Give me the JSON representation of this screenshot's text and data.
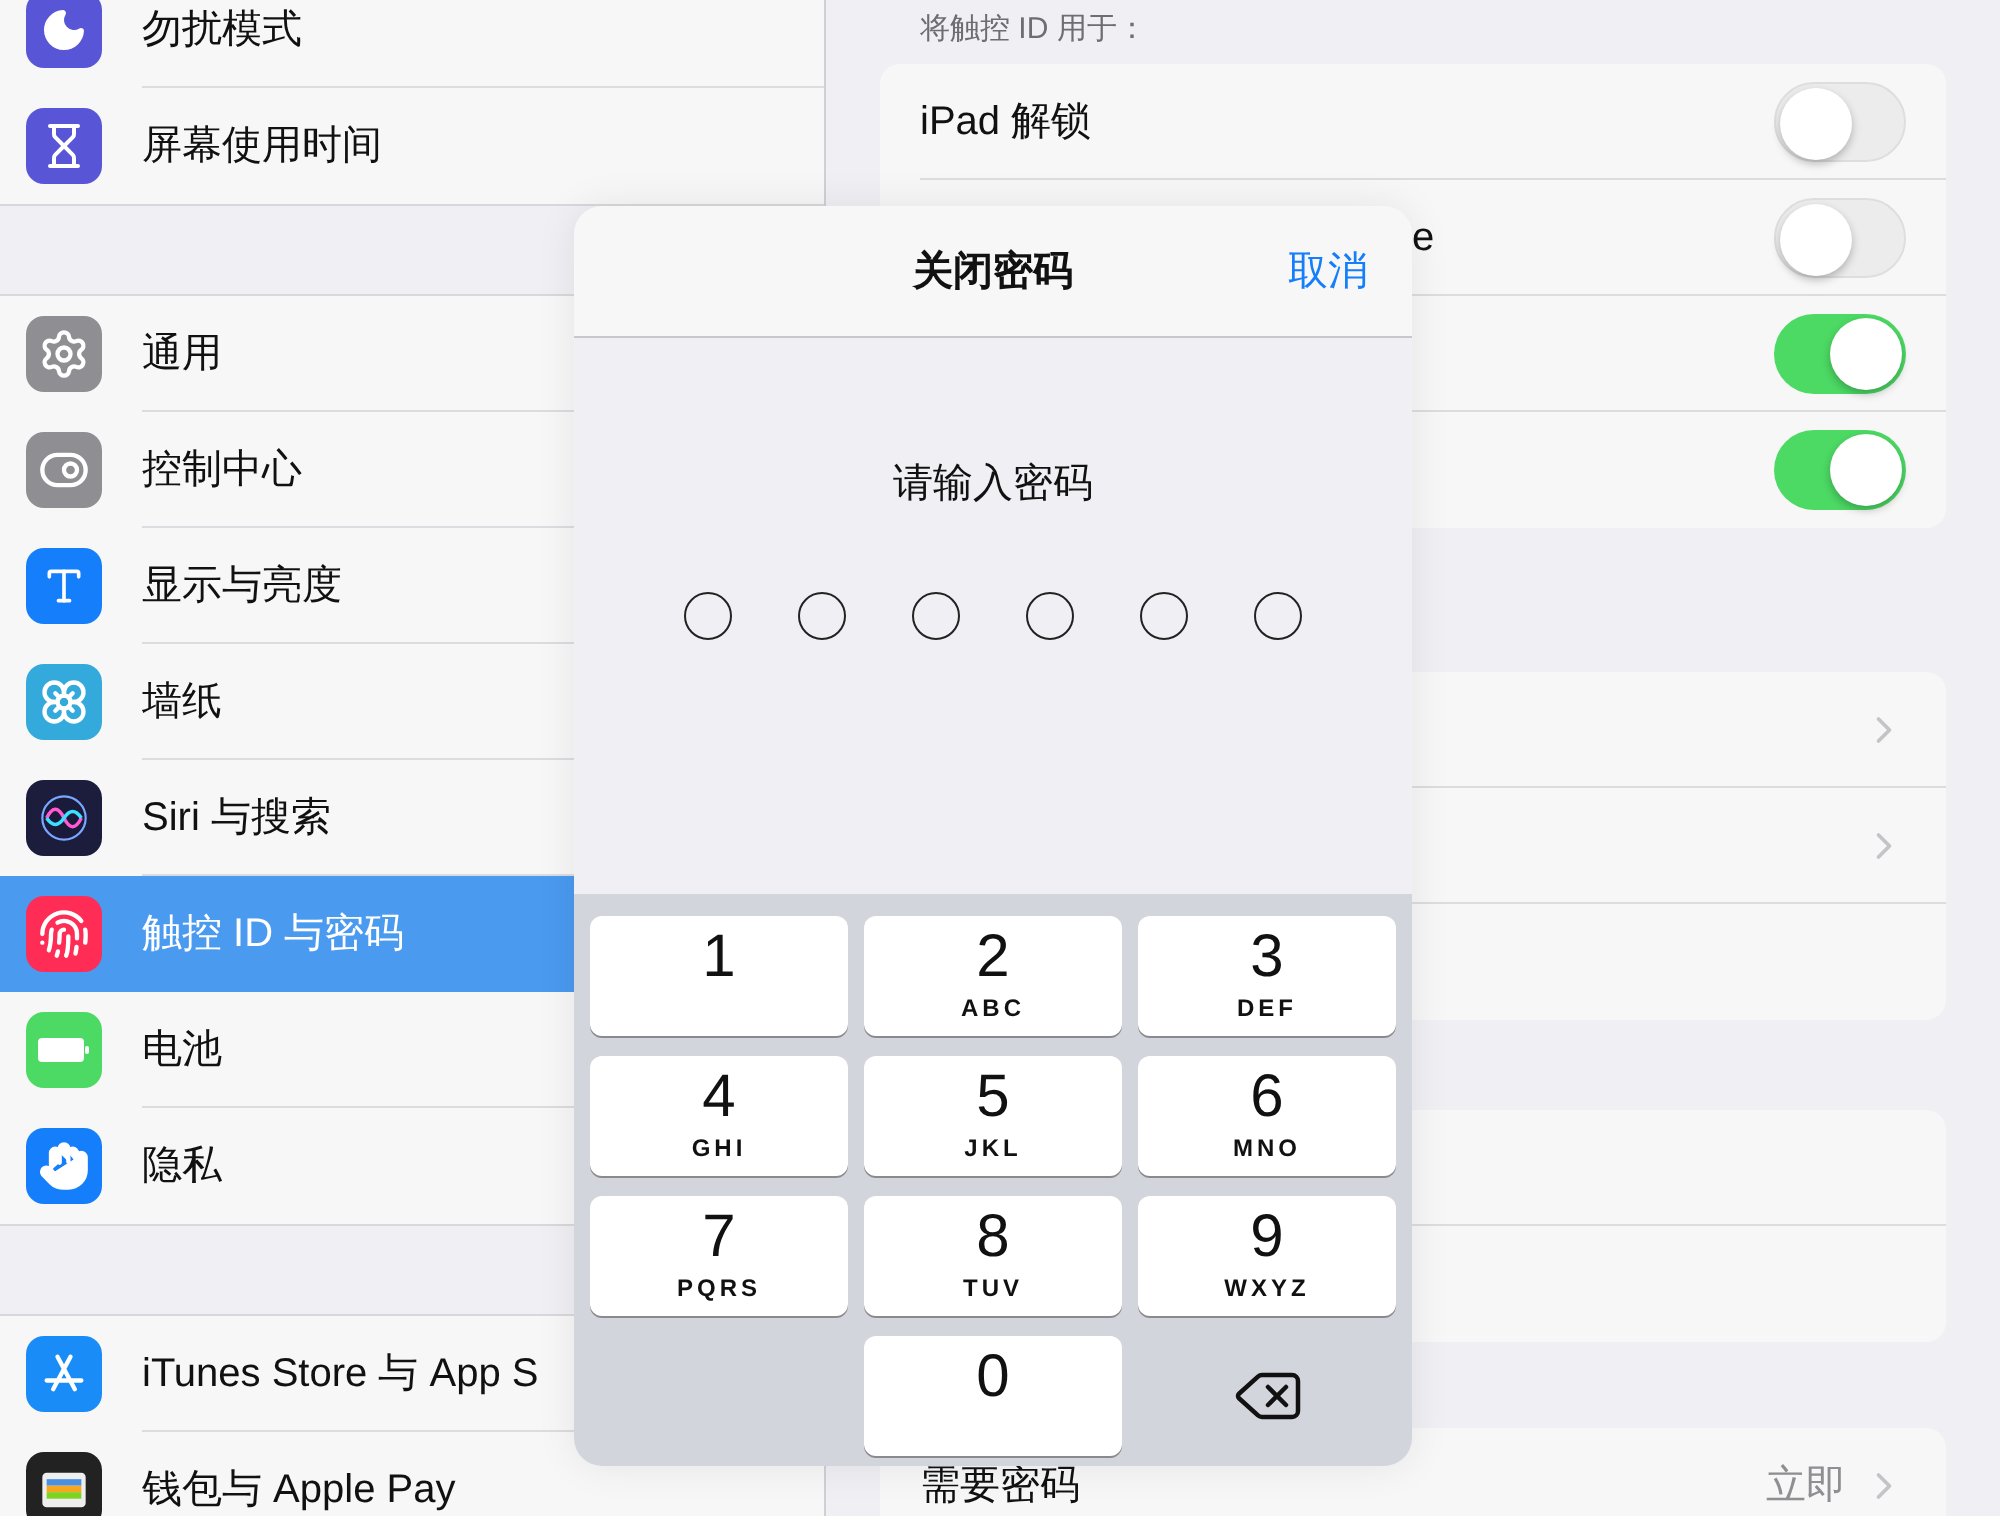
{
  "sidebar": {
    "groups": [
      {
        "items": [
          {
            "label": "勿扰模式",
            "selected": false
          },
          {
            "label": "屏幕使用时间",
            "selected": false
          }
        ]
      },
      {
        "items": [
          {
            "label": "通用",
            "selected": false
          },
          {
            "label": "控制中心",
            "selected": false
          },
          {
            "label": "显示与亮度",
            "selected": false
          },
          {
            "label": "墙纸",
            "selected": false
          },
          {
            "label": "Siri 与搜索",
            "selected": false
          },
          {
            "label": "触控 ID 与密码",
            "selected": true
          },
          {
            "label": "电池",
            "selected": false
          },
          {
            "label": "隐私",
            "selected": false
          }
        ]
      },
      {
        "items": [
          {
            "label": "iTunes Store 与 App S",
            "selected": false
          },
          {
            "label": "钱包与 Apple Pay",
            "selected": false
          }
        ]
      }
    ]
  },
  "sections": [
    {
      "header": "将触控 ID 用于：",
      "rows": [
        {
          "kind": "toggle",
          "label": "iPad 解锁",
          "on": false
        },
        {
          "kind": "toggle",
          "label": "e",
          "on": false,
          "partly_covered": true
        },
        {
          "kind": "toggle",
          "on": true
        },
        {
          "kind": "toggle",
          "on": true
        }
      ]
    },
    {
      "rows": [
        {
          "kind": "chevron"
        },
        {
          "kind": "chevron"
        },
        {
          "kind": "blank"
        }
      ]
    },
    {
      "rows": [
        {
          "kind": "blank"
        },
        {
          "kind": "blank"
        }
      ]
    },
    {
      "rows": [
        {
          "kind": "value",
          "label": "需要密码",
          "value": "立即"
        }
      ]
    }
  ],
  "dialog": {
    "title": "关闭密码",
    "cancel": "取消",
    "prompt": "请输入密码",
    "digits_entered": [
      false,
      false,
      false,
      false,
      false,
      false
    ],
    "keys": [
      {
        "kind": "digit",
        "digit": "1"
      },
      {
        "kind": "digit",
        "digit": "2",
        "letters": "ABC"
      },
      {
        "kind": "digit",
        "digit": "3",
        "letters": "DEF"
      },
      {
        "kind": "digit",
        "digit": "4",
        "letters": "GHI"
      },
      {
        "kind": "digit",
        "digit": "5",
        "letters": "JKL"
      },
      {
        "kind": "digit",
        "digit": "6",
        "letters": "MNO"
      },
      {
        "kind": "digit",
        "digit": "7",
        "letters": "PQRS"
      },
      {
        "kind": "digit",
        "digit": "8",
        "letters": "TUV"
      },
      {
        "kind": "digit",
        "digit": "9",
        "letters": "WXYZ"
      },
      {
        "kind": "blank"
      },
      {
        "kind": "digit",
        "digit": "0"
      },
      {
        "kind": "delete"
      }
    ]
  }
}
